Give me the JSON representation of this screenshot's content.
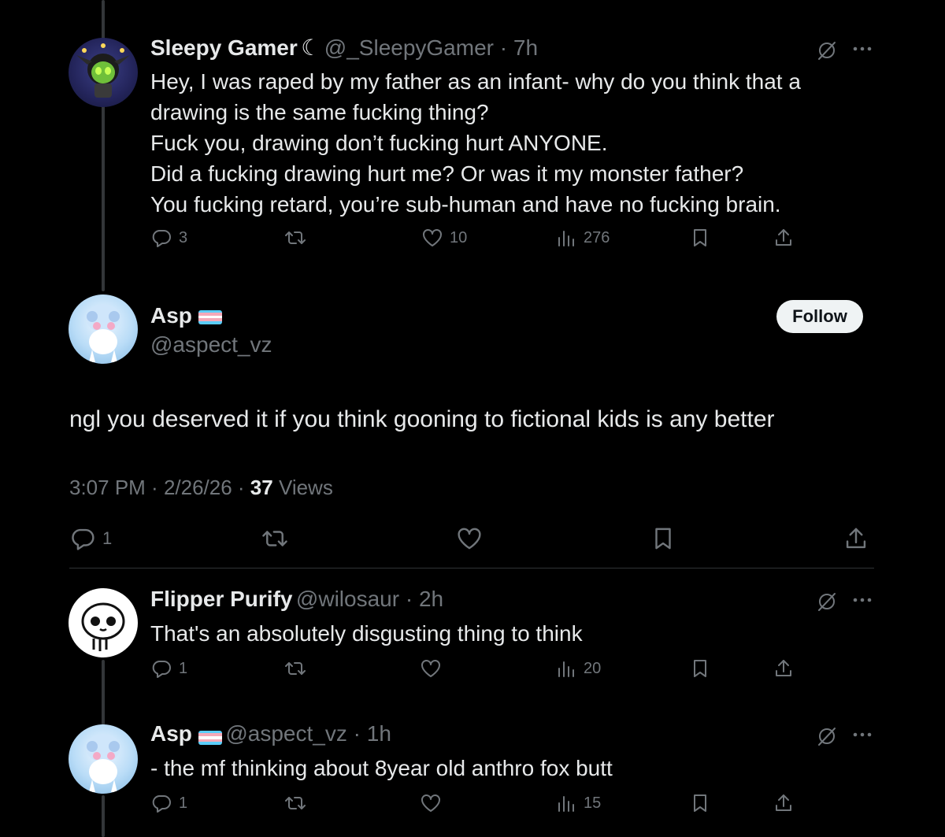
{
  "colors": {
    "background": "#000000",
    "text": "#e7e9ea",
    "muted": "#71767b",
    "divider": "#2f3336"
  },
  "posts": [
    {
      "name": "Sleepy Gamer",
      "name_suffix": "☾",
      "handle": "@_SleepyGamer",
      "time": "7h",
      "text": "Hey, I was raped by my father as an infant- why do you think that a\ndrawing is the same fucking thing?\nFuck you, drawing don’t fucking hurt ANYONE.\nDid a fucking drawing hurt me? Or was it my monster father?\nYou fucking retard, you’re sub-human and have no fucking brain.",
      "replies": "3",
      "likes": "10",
      "views": "276"
    },
    {
      "name": "Flipper Purify",
      "handle": "@wilosaur",
      "time": "2h",
      "text": "That's an absolutely disgusting thing to think",
      "replies": "1",
      "views": "20"
    },
    {
      "name": "Asp",
      "handle": "@aspect_vz",
      "time": "1h",
      "text": "- the mf thinking about 8year old anthro fox butt",
      "replies": "1",
      "views": "15"
    }
  ],
  "main": {
    "name": "Asp",
    "handle": "@aspect_vz",
    "follow_label": "Follow",
    "text": "ngl you deserved it if you think gooning to fictional kids is any better",
    "time": "3:07 PM",
    "date": "2/26/26",
    "views_count": "37",
    "views_label": "Views",
    "replies": "1"
  },
  "icons": [
    "grok-icon",
    "more-icon",
    "reply-icon",
    "retweet-icon",
    "like-icon",
    "views-icon",
    "bookmark-icon",
    "share-icon",
    "trans-flag-icon"
  ]
}
